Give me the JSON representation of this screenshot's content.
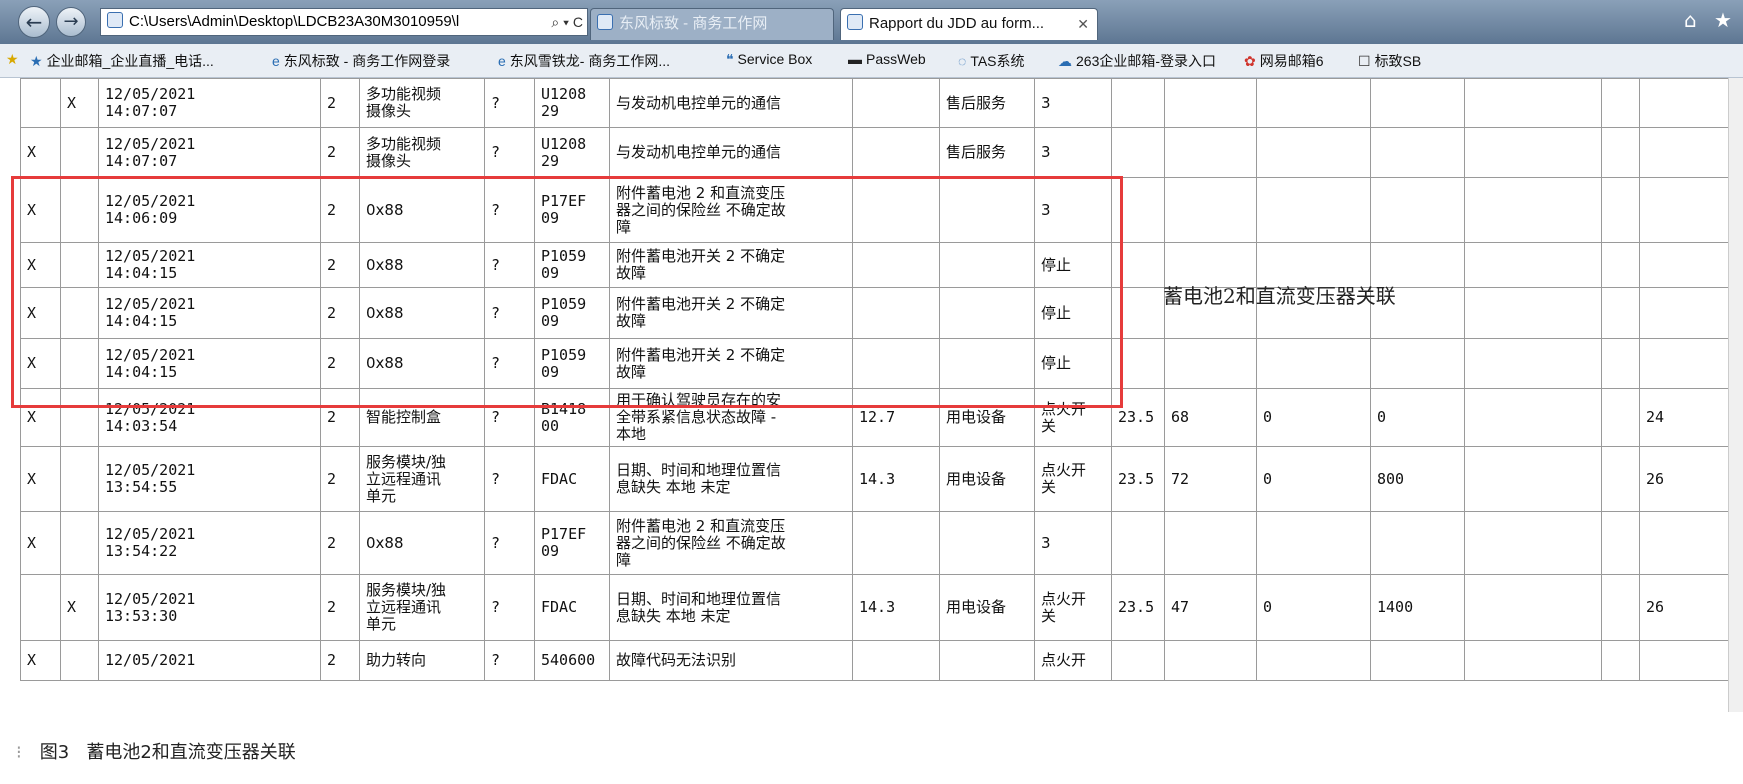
{
  "browser": {
    "address": "C:\\Users\\Admin\\Desktop\\LDCB23A30M3010959\\l",
    "address_controls": "⌕ ▾ C",
    "tabs": [
      {
        "label": "东风标致 - 商务工作网"
      },
      {
        "label": "Rapport du JDD au form..."
      }
    ],
    "favorites": [
      {
        "label": "企业邮箱_企业直播_电话...",
        "icon": "★"
      },
      {
        "label": "东风标致 - 商务工作网登录",
        "icon": "e"
      },
      {
        "label": "东风雪铁龙- 商务工作网...",
        "icon": "e"
      },
      {
        "label": "Service Box",
        "icon": "❝"
      },
      {
        "label": "PassWeb",
        "icon": "▬"
      },
      {
        "label": "TAS系统",
        "icon": "◌"
      },
      {
        "label": "263企业邮箱-登录入口",
        "icon": "☁"
      },
      {
        "label": "网易邮箱6",
        "icon": "✿"
      },
      {
        "label": "标致SB",
        "icon": "☐"
      }
    ]
  },
  "rows": [
    {
      "c1": "",
      "c2": "X",
      "time": "12/05/2021\n14:07:07",
      "n": "2",
      "module": "多功能视频\n摄像头",
      "q": "?",
      "code": "U1208\n29",
      "desc": "与发动机电控单元的通信",
      "v": "",
      "cat": "售后服务",
      "state": "3",
      "e1": "",
      "e2": "",
      "e3": "",
      "e4": "",
      "e5": "",
      "e6": ""
    },
    {
      "c1": "X",
      "c2": "",
      "time": "12/05/2021\n14:07:07",
      "n": "2",
      "module": "多功能视频\n摄像头",
      "q": "?",
      "code": "U1208\n29",
      "desc": "与发动机电控单元的通信",
      "v": "",
      "cat": "售后服务",
      "state": "3",
      "e1": "",
      "e2": "",
      "e3": "",
      "e4": "",
      "e5": "",
      "e6": ""
    },
    {
      "c1": "X",
      "c2": "",
      "time": "12/05/2021\n14:06:09",
      "n": "2",
      "module": "0x88",
      "q": "?",
      "code": "P17EF\n09",
      "desc": "附件蓄电池 2 和直流变压\n器之间的保险丝 不确定故\n障",
      "v": "",
      "cat": "",
      "state": "3",
      "e1": "",
      "e2": "",
      "e3": "",
      "e4": "",
      "e5": "",
      "e6": ""
    },
    {
      "c1": "X",
      "c2": "",
      "time": "12/05/2021\n14:04:15",
      "n": "2",
      "module": "0x88",
      "q": "?",
      "code": "P1059\n09",
      "desc": "附件蓄电池开关 2 不确定\n故障",
      "v": "",
      "cat": "",
      "state": "停止",
      "e1": "",
      "e2": "",
      "e3": "",
      "e4": "",
      "e5": "",
      "e6": ""
    },
    {
      "c1": "X",
      "c2": "",
      "time": "12/05/2021\n14:04:15",
      "n": "2",
      "module": "0x88",
      "q": "?",
      "code": "P1059\n09",
      "desc": "附件蓄电池开关 2 不确定\n故障",
      "v": "",
      "cat": "",
      "state": "停止",
      "e1": "",
      "e2": "",
      "e3": "",
      "e4": "",
      "e5": "",
      "e6": ""
    },
    {
      "c1": "X",
      "c2": "",
      "time": "12/05/2021\n14:04:15",
      "n": "2",
      "module": "0x88",
      "q": "?",
      "code": "P1059\n09",
      "desc": "附件蓄电池开关 2 不确定\n故障",
      "v": "",
      "cat": "",
      "state": "停止",
      "e1": "",
      "e2": "",
      "e3": "",
      "e4": "",
      "e5": "",
      "e6": ""
    },
    {
      "c1": "X",
      "c2": "",
      "time": "12/05/2021\n14:03:54",
      "n": "2",
      "module": "智能控制盒",
      "q": "?",
      "code": "B1418\n00",
      "desc": "用于确认驾驶员存在的安\n全带系紧信息状态故障 -\n本地",
      "v": "12.7",
      "cat": "用电设备",
      "state": "点火开\n关",
      "e1": "23.5",
      "e2": "68",
      "e3": "0",
      "e4": "0",
      "e5": "",
      "e6": "24"
    },
    {
      "c1": "X",
      "c2": "",
      "time": "12/05/2021\n13:54:55",
      "n": "2",
      "module": "服务模块/独\n立远程通讯\n单元",
      "q": "?",
      "code": "FDAC",
      "desc": "日期、时间和地理位置信\n息缺失 本地 未定",
      "v": "14.3",
      "cat": "用电设备",
      "state": "点火开\n关",
      "e1": "23.5",
      "e2": "72",
      "e3": "0",
      "e4": "800",
      "e5": "",
      "e6": "26"
    },
    {
      "c1": "X",
      "c2": "",
      "time": "12/05/2021\n13:54:22",
      "n": "2",
      "module": "0x88",
      "q": "?",
      "code": "P17EF\n09",
      "desc": "附件蓄电池 2 和直流变压\n器之间的保险丝 不确定故\n障",
      "v": "",
      "cat": "",
      "state": "3",
      "e1": "",
      "e2": "",
      "e3": "",
      "e4": "",
      "e5": "",
      "e6": ""
    },
    {
      "c1": "",
      "c2": "X",
      "time": "12/05/2021\n13:53:30",
      "n": "2",
      "module": "服务模块/独\n立远程通讯\n单元",
      "q": "?",
      "code": "FDAC",
      "desc": "日期、时间和地理位置信\n息缺失 本地 未定",
      "v": "14.3",
      "cat": "用电设备",
      "state": "点火开\n关",
      "e1": "23.5",
      "e2": "47",
      "e3": "0",
      "e4": "1400",
      "e5": "",
      "e6": "26"
    },
    {
      "c1": "X",
      "c2": "",
      "time": "12/05/2021",
      "n": "2",
      "module": "助力转向",
      "q": "?",
      "code": "540600",
      "desc": "故障代码无法识别",
      "v": "",
      "cat": "",
      "state": "点火开",
      "e1": "",
      "e2": "",
      "e3": "",
      "e4": "",
      "e5": "",
      "e6": ""
    }
  ],
  "annotation": "蓄电池2和直流变压器关联",
  "caption": {
    "fig": "图3",
    "text": "蓄电池2和直流变压器关联"
  }
}
